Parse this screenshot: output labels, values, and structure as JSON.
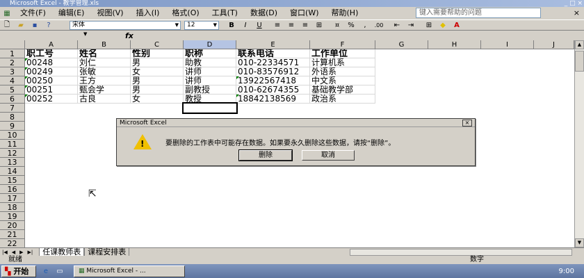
{
  "window": {
    "title": "Microsoft Excel - 教学管理.xls",
    "min": "_",
    "max": "□",
    "close": "×"
  },
  "menu": {
    "items": [
      "文件(F)",
      "编辑(E)",
      "视图(V)",
      "插入(I)",
      "格式(O)",
      "工具(T)",
      "数据(D)",
      "窗口(W)",
      "帮助(H)"
    ],
    "help_placeholder": "键入需要帮助的问题",
    "doc_close": "×"
  },
  "toolbar": {
    "font_name": "宋体",
    "font_size": "12",
    "bold": "B",
    "italic": "I",
    "underline": "U",
    "percent": "%",
    "comma": ",",
    "decimal": ".00"
  },
  "formula": {
    "fx": "fx"
  },
  "columns": [
    "A",
    "B",
    "C",
    "D",
    "E",
    "F",
    "G",
    "H",
    "I",
    "J"
  ],
  "rows": [
    "1",
    "2",
    "3",
    "4",
    "5",
    "6",
    "7",
    "8",
    "9",
    "10",
    "11",
    "12",
    "13",
    "14",
    "15",
    "16",
    "17",
    "18",
    "19",
    "20",
    "21",
    "22"
  ],
  "table": {
    "headers": [
      "职工号",
      "姓名",
      "性别",
      "职称",
      "联系电话",
      "工作单位"
    ],
    "data": [
      [
        "00248",
        "刘仁",
        "男",
        "助教",
        "010-22334571",
        "计算机系"
      ],
      [
        "00249",
        "张敏",
        "女",
        "讲师",
        "010-83576912",
        "外语系"
      ],
      [
        "00250",
        "王方",
        "男",
        "讲师",
        "13922567418",
        "中文系"
      ],
      [
        "00251",
        "甄会学",
        "男",
        "副教授",
        "010-62674355",
        "基础教学部"
      ],
      [
        "00252",
        "古良",
        "女",
        "教授",
        "18842138569",
        "政治系"
      ]
    ]
  },
  "sheets": {
    "tabs": [
      "任课教师表",
      "课程安排表"
    ]
  },
  "status": {
    "left": "就绪",
    "right": "数字"
  },
  "taskbar": {
    "start": "开始",
    "task": "Microsoft Excel - ...",
    "clock": "9:00"
  },
  "dialog": {
    "title": "Microsoft Excel",
    "close": "×",
    "message": "要删除的工作表中可能存在数据。如果要永久删除这些数据，请按“删除”。",
    "ok": "删除",
    "cancel": "取消"
  }
}
